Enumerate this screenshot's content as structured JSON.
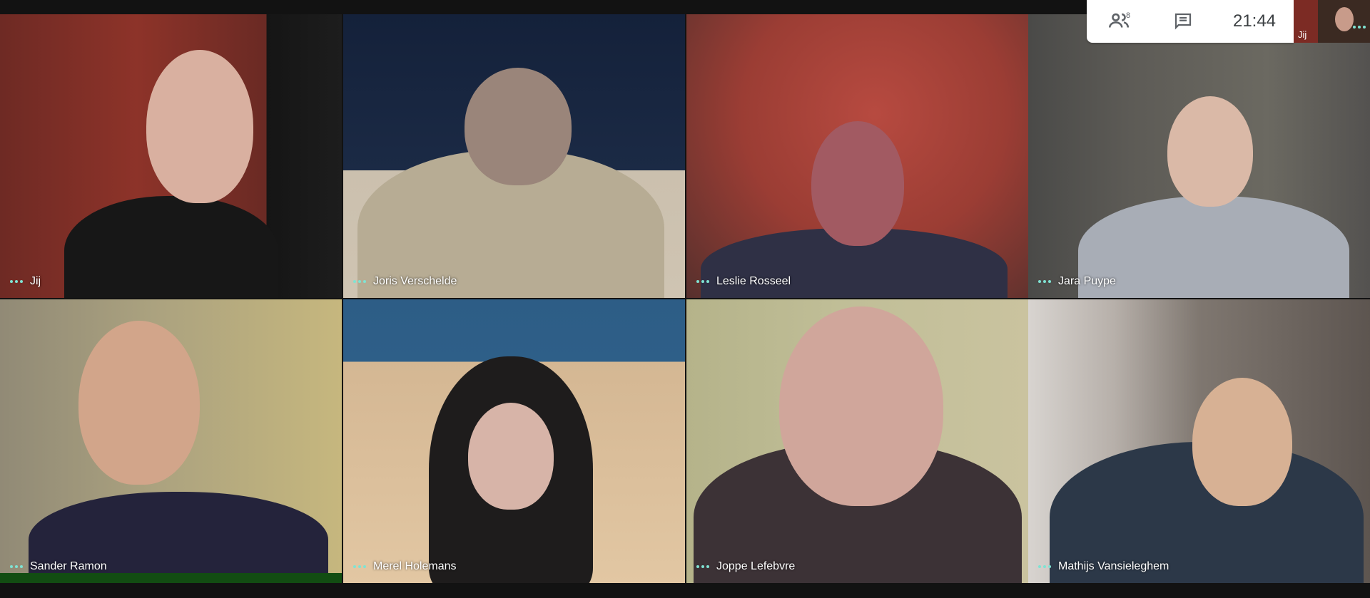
{
  "toolbar": {
    "participant_count": "8",
    "time": "21:44",
    "self_label": "Jij"
  },
  "participants": [
    {
      "name": "Jij"
    },
    {
      "name": "Joris Verschelde"
    },
    {
      "name": "Leslie Rosseel"
    },
    {
      "name": "Jara Puype"
    },
    {
      "name": "Sander Ramon"
    },
    {
      "name": "Merel Holemans"
    },
    {
      "name": "Joppe Lefebvre"
    },
    {
      "name": "Mathijs Vansieleghem"
    }
  ],
  "icons": {
    "people": "people-icon",
    "chat": "chat-icon",
    "more": "more-dots-icon"
  },
  "colors": {
    "speaking_indicator": "#7fe3d3",
    "background": "#121212"
  }
}
